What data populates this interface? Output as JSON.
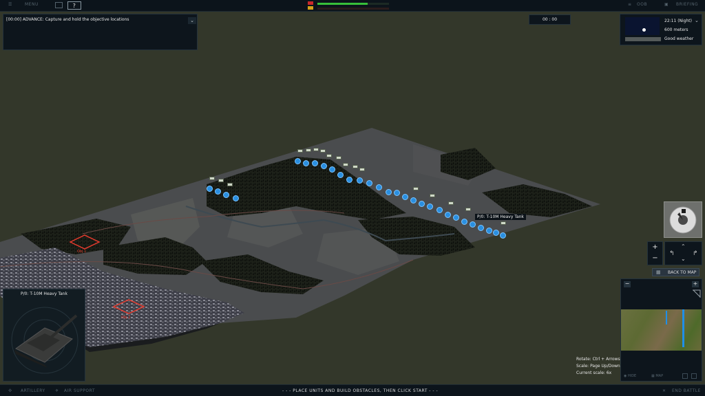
{
  "topbar": {
    "menu_label": "MENU",
    "help_label": "?",
    "oob_label": "OOB",
    "briefing_label": "BRIEFING",
    "player_strength_pct": 70,
    "enemy_strength_pct": 0
  },
  "objective": {
    "text": "[00:00] ADVANCE: Capture and hold the objective locations"
  },
  "timer": {
    "value": "00 : 00"
  },
  "weather": {
    "time": "22:11 (Night)",
    "visibility": "600 meters",
    "conditions": "Good weather"
  },
  "map_tooltip": {
    "text": "P/0: T-10M Heavy Tank"
  },
  "objective_zones": [
    {
      "label": "Obj 1"
    },
    {
      "label": "Obj 2"
    }
  ],
  "unit_card": {
    "title": "P/0: T-10M Heavy Tank"
  },
  "camera_controls": {
    "zoom_in": "+",
    "zoom_out": "−",
    "back_to_map": "BACK TO MAP"
  },
  "minimap": {
    "minus": "−",
    "plus": "+",
    "footer_1": "HIDE",
    "footer_2": "MAP"
  },
  "help_text": {
    "rotate": "Rotate: Ctrl + Arrows",
    "scale": "Scale: Page Up/Down",
    "current_scale": "Current scale: 6x"
  },
  "bottombar": {
    "artillery_label": "ARTILLERY",
    "air_support_label": "AIR SUPPORT",
    "instruction": "- - -   PLACE UNITS AND BUILD OBSTACLES, THEN CLICK START   - - -",
    "end_battle_label": "END BATTLE"
  },
  "colors": {
    "friendly": "#2a8fe0",
    "objective": "#e53b2e",
    "accent_green": "#37c03a"
  }
}
